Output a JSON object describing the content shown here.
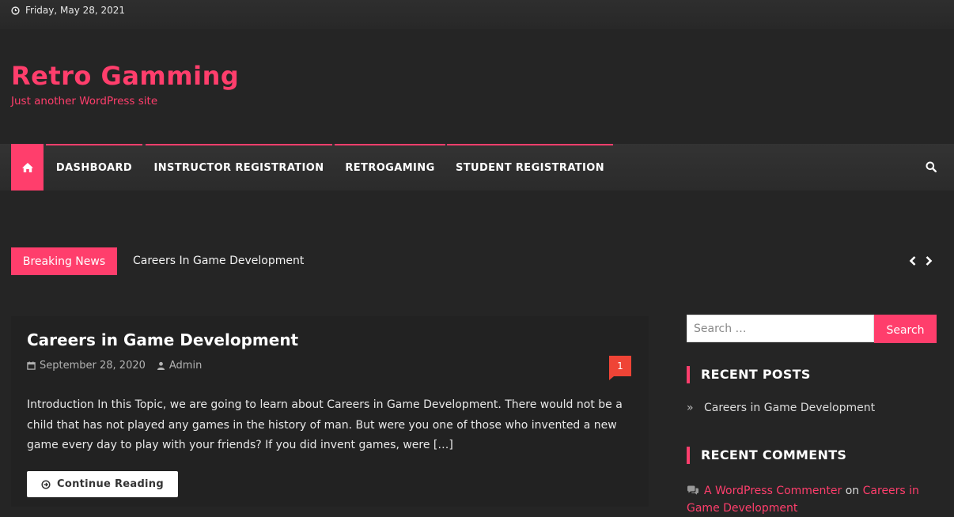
{
  "topbar": {
    "date": "Friday, May 28, 2021",
    "clock_icon": "clock-icon"
  },
  "branding": {
    "title": "Retro Gamming",
    "tagline": "Just another WordPress site"
  },
  "nav": {
    "home_icon": "home-icon",
    "items": [
      {
        "label": "DASHBOARD"
      },
      {
        "label": "INSTRUCTOR REGISTRATION"
      },
      {
        "label": "RETROGAMING"
      },
      {
        "label": "STUDENT REGISTRATION"
      }
    ],
    "search_icon": "search-icon"
  },
  "ticker": {
    "label": "Breaking News",
    "headline": "Careers In Game Development"
  },
  "post": {
    "title": "Careers in Game Development",
    "date": "September 28, 2020",
    "author": "Admin",
    "comment_count": "1",
    "excerpt": "Introduction In this Topic, we are going to learn about Careers in Game Development. There would not be a child that has not played any games in the history of man. But were you one of those who invented a new game every day to play with your friends? If you did invent games, were […]",
    "continue_label": "Continue Reading"
  },
  "sidebar": {
    "search": {
      "placeholder": "Search …",
      "button_label": "Search"
    },
    "recent_posts": {
      "title": "RECENT POSTS",
      "items": [
        "Careers in Game Development"
      ]
    },
    "recent_comments": {
      "title": "RECENT COMMENTS",
      "items": [
        {
          "author": "A WordPress Commenter",
          "connector": "on",
          "post": "Careers in Game Development"
        }
      ]
    }
  },
  "colors": {
    "accent": "#ff3e6c",
    "background": "#252525",
    "badge": "#ef4436"
  }
}
